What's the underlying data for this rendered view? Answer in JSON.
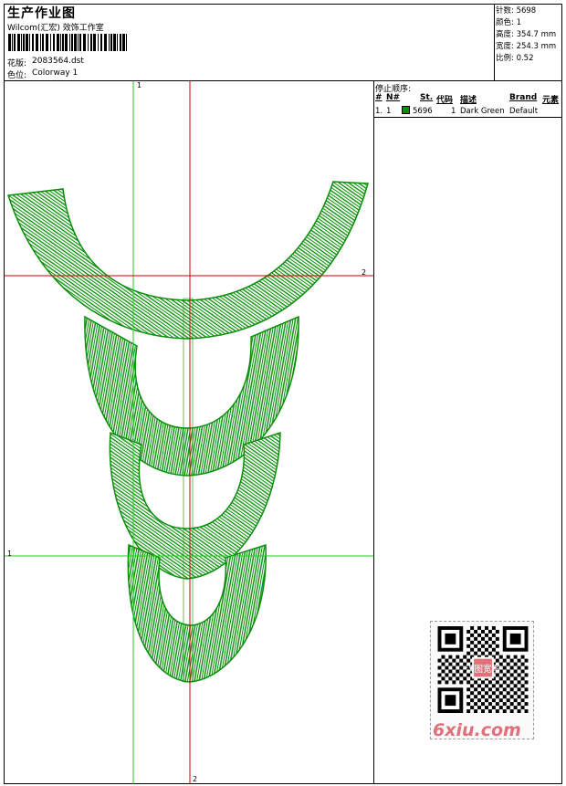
{
  "header": {
    "title": "生产作业图",
    "company": "Wilcom(汇宏) 效饰工作室",
    "design_label": "花版:",
    "design_value": "2083564.dst",
    "color_label": "色位:",
    "color_value": "Colorway 1"
  },
  "stats": {
    "stitches": "针数: 5698",
    "colors": "颜色: 1",
    "height": "高度: 354.7 mm",
    "width": "宽度: 254.3 mm",
    "scale": "比例: 0.52"
  },
  "stop_sequence": {
    "heading": "停止顺序:",
    "columns": [
      "#",
      "N#",
      "St.",
      "代码",
      "描述",
      "Brand",
      "元素"
    ],
    "rows": [
      {
        "index": "1.",
        "needle": "1",
        "stitches": "5696",
        "code": "1",
        "description": "Dark Green",
        "brand": "Default",
        "color": "#0a8f0a"
      }
    ]
  },
  "guides": {
    "green_top": "1",
    "green_left": "1",
    "red_right": "2",
    "red_bottom": "2"
  },
  "watermark": {
    "site": "6xiu.com",
    "stamp": "汉图宽图"
  },
  "colors": {
    "stitch": "#0a8f0a",
    "guide_red": "#cc0000",
    "guide_green": "#22cc22"
  }
}
